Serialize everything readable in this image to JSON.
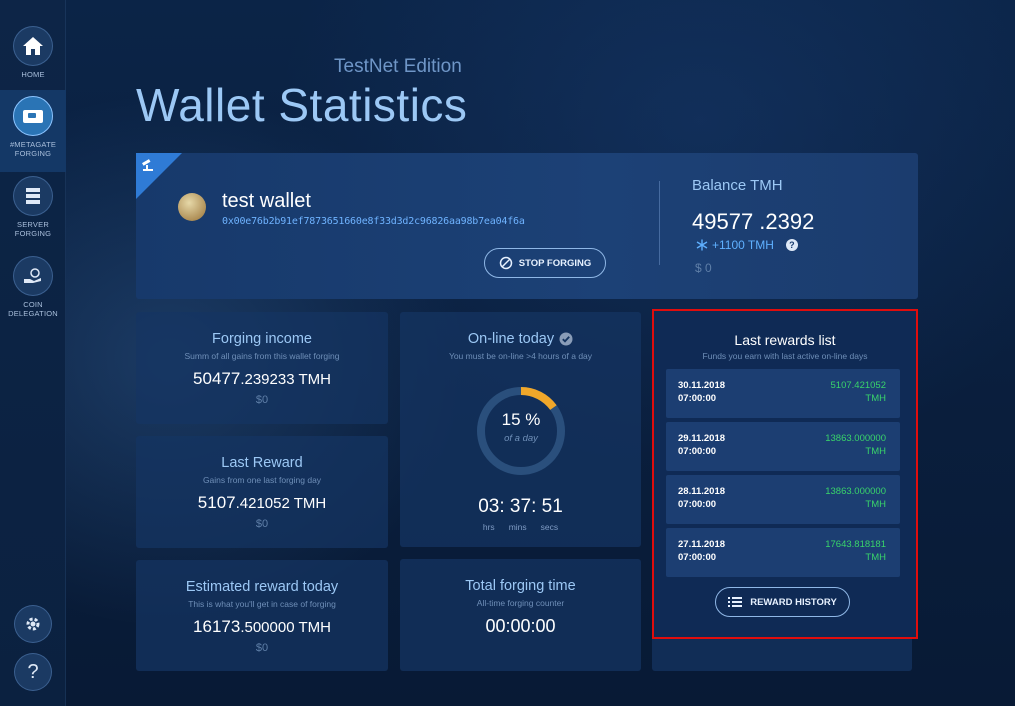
{
  "nav": {
    "home": "HOME",
    "metagate": "#METAGATE\nFORGING",
    "server": "SERVER\nFORGING",
    "delegation": "COIN\nDELEGATION",
    "help_glyph": "?"
  },
  "header": {
    "edition": "TestNet Edition",
    "title": "Wallet Statistics"
  },
  "wallet": {
    "name": "test wallet",
    "address": "0x00e76b2b91ef7873651660e8f33d3d2c96826aa98b7ea04f6a",
    "stop_label": "STOP FORGING"
  },
  "balance": {
    "title": "Balance TMH",
    "int": "49577",
    "frac": " .2392",
    "bonus": "+1100 TMH",
    "help": "?",
    "usd": "$ 0"
  },
  "forging_income": {
    "title": "Forging income",
    "subtitle": "Summ of all gains from this wallet forging",
    "int": "50477",
    "frac": ".239233 TMH",
    "usd": "$0"
  },
  "last_reward": {
    "title": "Last Reward",
    "subtitle": "Gains from one last forging day",
    "int": "5107",
    "frac": ".421052 TMH",
    "usd": "$0"
  },
  "estimated": {
    "title": "Estimated reward today",
    "subtitle": "This is what you'll get in case of forging",
    "int": "16173",
    "frac": ".500000 TMH",
    "usd": "$0"
  },
  "online": {
    "title": "On-line today",
    "subtitle": "You must be on-line >4 hours of a day",
    "percent_label": "15 %",
    "percent_value": 15,
    "of_a_day": "of a day",
    "hrs": "03",
    "mins": "37",
    "secs": "51",
    "hrs_label": "hrs",
    "mins_label": "mins",
    "secs_label": "secs",
    "colors": {
      "track": "#2a4f7c",
      "fill": "#f0a72a"
    }
  },
  "total_forging": {
    "title": "Total forging time",
    "subtitle": "All-time forging counter",
    "value": "00:00:00"
  },
  "rewards": {
    "title": "Last rewards list",
    "subtitle": "Funds you earn with last active on-line days",
    "items": [
      {
        "date": "30.11.2018",
        "time": "07:00:00",
        "amount": "5107.421052",
        "unit": "TMH"
      },
      {
        "date": "29.11.2018",
        "time": "07:00:00",
        "amount": "13863.000000",
        "unit": "TMH"
      },
      {
        "date": "28.11.2018",
        "time": "07:00:00",
        "amount": "13863.000000",
        "unit": "TMH"
      },
      {
        "date": "27.11.2018",
        "time": "07:00:00",
        "amount": "17643.818181",
        "unit": "TMH"
      }
    ],
    "history_label": "REWARD HISTORY"
  }
}
